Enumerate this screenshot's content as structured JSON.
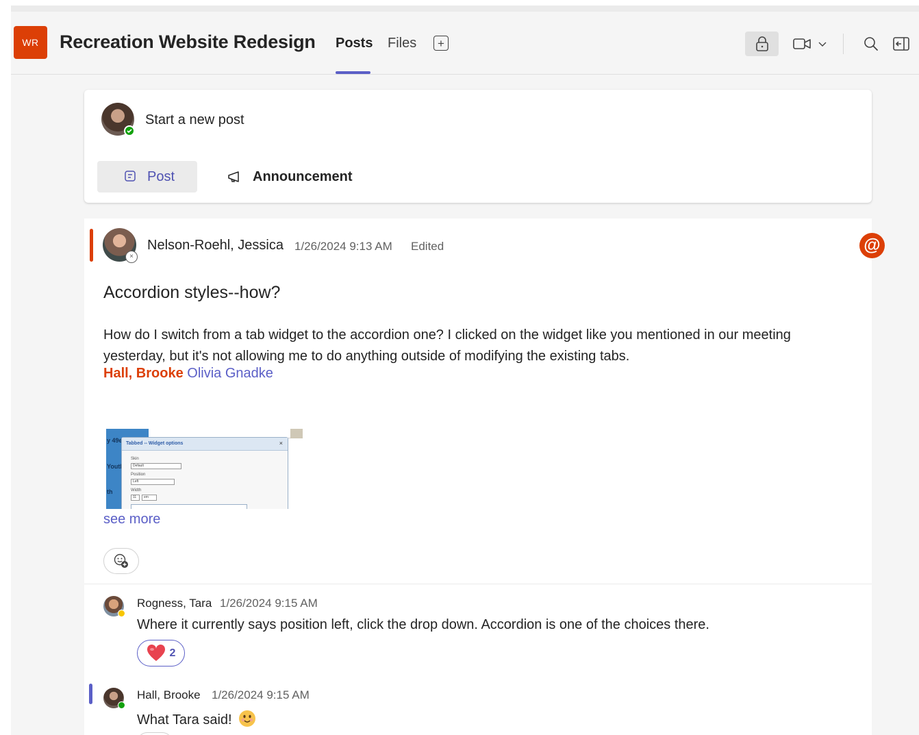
{
  "header": {
    "team_initials": "WR",
    "team_name": "Recreation Website Redesign",
    "tabs": [
      {
        "label": "Posts",
        "active": true
      },
      {
        "label": "Files",
        "active": false
      }
    ],
    "icons": [
      "plus-icon",
      "lock-icon",
      "video-icon",
      "chevron-down-icon",
      "search-icon",
      "panel-icon"
    ]
  },
  "new_post": {
    "placeholder": "Start a new post",
    "post_label": "Post",
    "announcement_label": "Announcement"
  },
  "thread": {
    "author": "Nelson-Roehl, Jessica",
    "timestamp": "1/26/2024 9:13 AM",
    "edited_label": "Edited",
    "mention_badge": "@",
    "subject": "Accordion styles--how?",
    "body": "How do I switch from a tab widget to the accordion one? I clicked on the widget like you mentioned in our meeting yesterday, but it's not allowing me to do anything outside of modifying the existing tabs.",
    "mentions": [
      "Hall, Brooke",
      "Olivia Gnadke"
    ],
    "attachment": {
      "dialog_title": "Tabbed -- Widget options",
      "close": "×",
      "side_labels": [
        "y 49er",
        "Youth",
        "th"
      ],
      "fields": [
        {
          "label": "Skin",
          "value": "Default"
        },
        {
          "label": "Position",
          "value": "Left"
        },
        {
          "label": "Width",
          "value": "11"
        }
      ],
      "unit": "em"
    },
    "see_more": "see more",
    "replies": [
      {
        "author": "Rogness, Tara",
        "timestamp": "1/26/2024 9:15 AM",
        "text": "Where it currently says position left, click the drop down.  Accordion is one of the choices there.",
        "reaction": {
          "emoji": "heart",
          "count": "2"
        }
      },
      {
        "author": "Hall, Brooke",
        "timestamp": "1/26/2024 9:15 AM",
        "text": "What Tara said!",
        "emoji": "smile"
      }
    ]
  },
  "colors": {
    "accent": "#5b5fc7",
    "brand_orange": "#dc3f06",
    "presence_green": "#13a10e",
    "presence_yellow": "#f8c600"
  }
}
